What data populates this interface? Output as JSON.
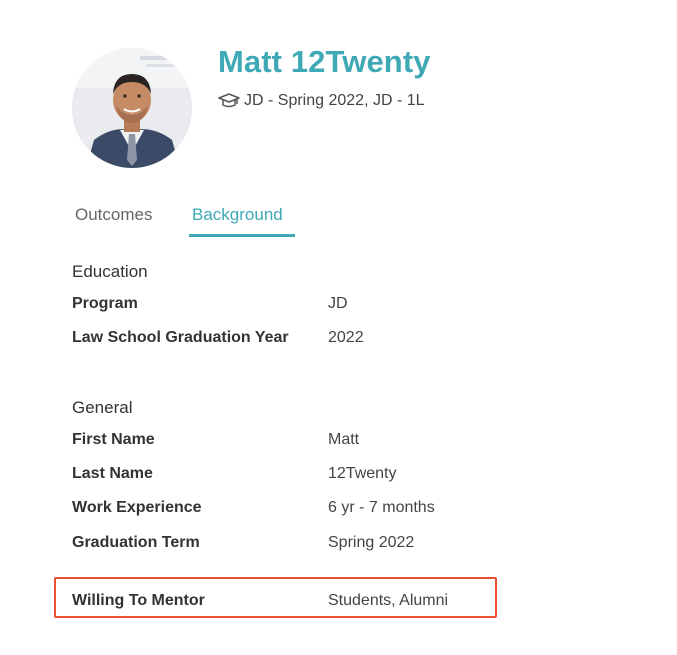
{
  "profile": {
    "name": "Matt 12Twenty",
    "subtitle": "JD - Spring 2022, JD - 1L",
    "subtitle_icon": "graduation-cap-icon",
    "avatar_icon": "profile-photo"
  },
  "tabs": [
    {
      "label": "Outcomes",
      "active": false
    },
    {
      "label": "Background",
      "active": true
    }
  ],
  "education": {
    "title": "Education",
    "fields": [
      {
        "label": "Program",
        "value": "JD"
      },
      {
        "label": "Law School Graduation Year",
        "value": "2022"
      }
    ]
  },
  "general": {
    "title": "General",
    "fields": [
      {
        "label": "First Name",
        "value": "Matt"
      },
      {
        "label": "Last Name",
        "value": "12Twenty"
      },
      {
        "label": "Work Experience",
        "value": "6 yr - 7 months"
      },
      {
        "label": "Graduation Term",
        "value": "Spring 2022"
      },
      {
        "label": "Willing To Mentor",
        "value": "Students, Alumni"
      }
    ]
  },
  "colors": {
    "accent": "#3fa9b5",
    "highlight": "#e8502f",
    "text": "#333333"
  }
}
